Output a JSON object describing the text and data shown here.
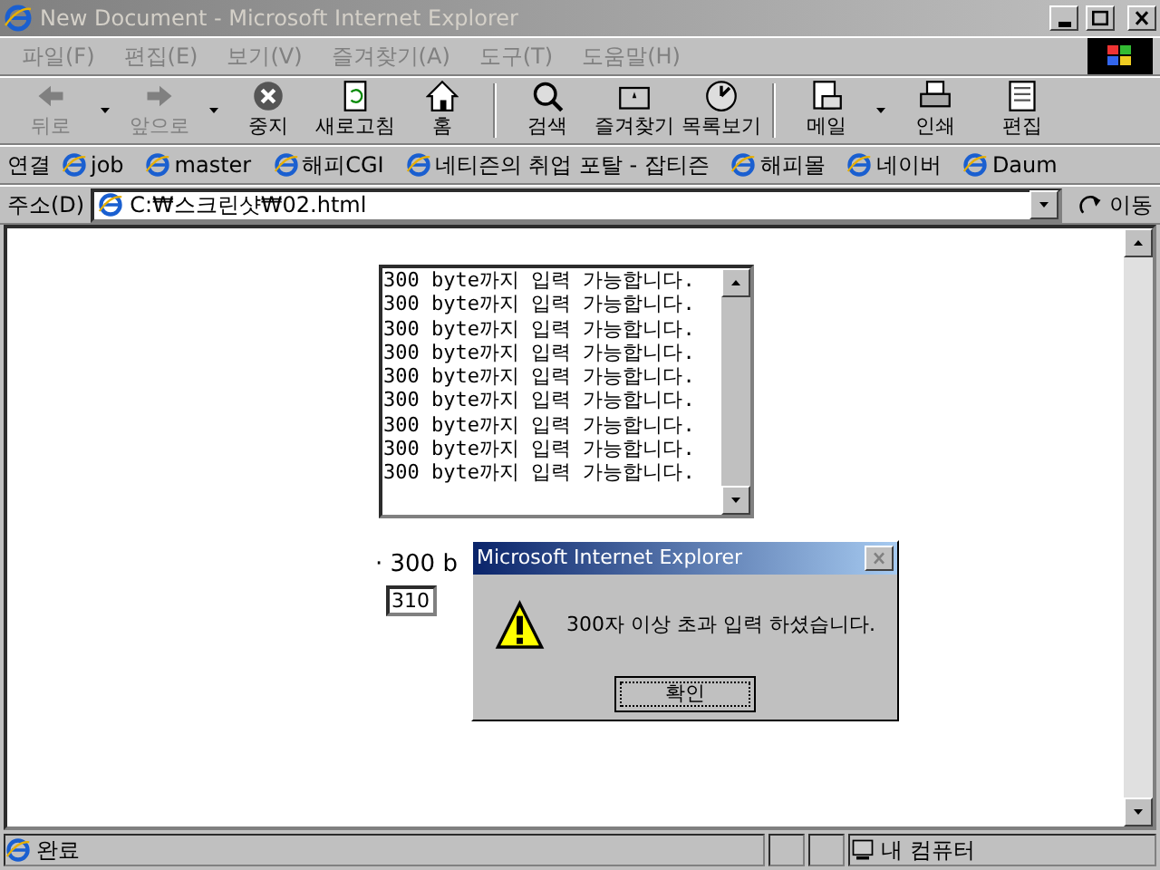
{
  "window": {
    "title": "New Document - Microsoft Internet Explorer",
    "active": false
  },
  "menu": [
    "파일(F)",
    "편집(E)",
    "보기(V)",
    "즐겨찾기(A)",
    "도구(T)",
    "도움말(H)"
  ],
  "toolbar": [
    {
      "label": "뒤로",
      "disabled": true,
      "dropdown": true
    },
    {
      "label": "앞으로",
      "disabled": true,
      "dropdown": true
    },
    {
      "label": "중지",
      "disabled": false,
      "dropdown": false
    },
    {
      "label": "새로고침",
      "disabled": false,
      "dropdown": false
    },
    {
      "label": "홈",
      "disabled": false,
      "dropdown": false
    },
    {
      "label": "검색",
      "disabled": false,
      "dropdown": false
    },
    {
      "label": "즐겨찾기",
      "disabled": false,
      "dropdown": false
    },
    {
      "label": "목록보기",
      "disabled": false,
      "dropdown": false
    },
    {
      "label": "메일",
      "disabled": false,
      "dropdown": true
    },
    {
      "label": "인쇄",
      "disabled": false,
      "dropdown": false
    },
    {
      "label": "편집",
      "disabled": false,
      "dropdown": false
    }
  ],
  "links": {
    "label": "연결",
    "items": [
      "job",
      "master",
      "해피CGI",
      "네티즌의 취업 포탈 - 잡티즌",
      "해피몰",
      "네이버",
      "Daum"
    ]
  },
  "address": {
    "label": "주소(D)",
    "value": "C:₩스크린샷₩02.html",
    "go": "이동"
  },
  "page": {
    "textarea_lines": [
      "300 byte까지 입력 가능합니다.",
      "300 byte까지 입력 가능합니다.",
      "300 byte까지 입력 가능합니다.",
      "300 byte까지 입력 가능합니다.",
      "300 byte까지 입력 가능합니다.",
      "300 byte까지 입력 가능합니다.",
      "300 byte까지 입력 가능합니다.",
      "300 byte까지 입력 가능합니다.",
      "300 byte까지 입력 가능합니다."
    ],
    "counter_label": "· 300 b",
    "counter_value": "310"
  },
  "dialog": {
    "title": "Microsoft Internet Explorer",
    "active": true,
    "message": "300자 이상 초과 입력 하셨습니다.",
    "button": "확인"
  },
  "status_bar": {
    "text": "완료",
    "zone": "내 컴퓨터"
  }
}
